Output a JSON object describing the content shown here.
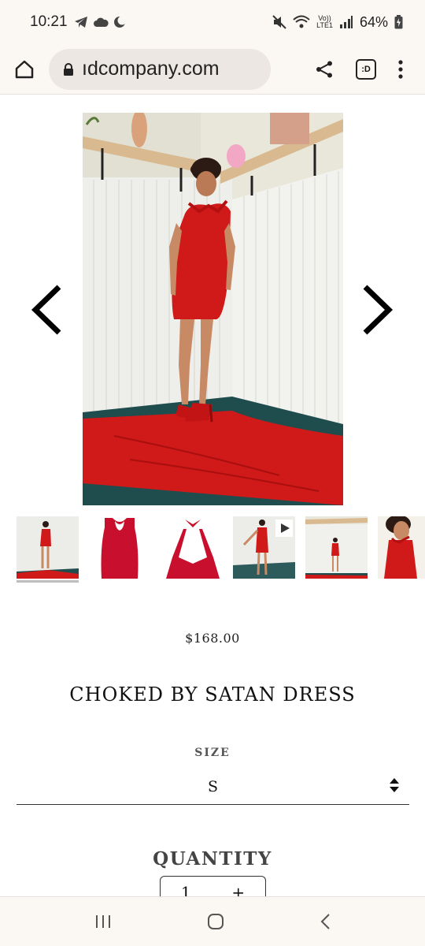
{
  "status_bar": {
    "time": "10:21",
    "battery": "64%",
    "network_top": "Vo))",
    "network_bottom": "LTE1"
  },
  "browser": {
    "url": "ıdcompany.com",
    "tab_count": ":D"
  },
  "product": {
    "price": "$168.00",
    "title": "CHOKED BY SATAN DRESS",
    "size_label": "SIZE",
    "size_value": "S",
    "quantity_label": "QUANTITY",
    "quantity_value": "1",
    "quantity_plus": "+"
  },
  "colors": {
    "dress_red": "#d01919",
    "page_bg": "#ffffff",
    "chrome_bg": "#fbf8f4"
  }
}
